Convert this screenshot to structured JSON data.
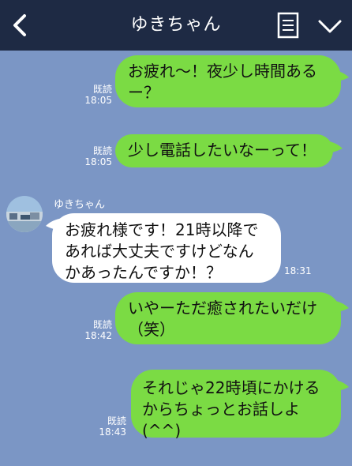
{
  "header": {
    "title": "ゆきちゃん",
    "back_icon": "chevron-left-icon",
    "memo_icon": "note-icon",
    "menu_icon": "chevron-down-icon"
  },
  "colors": {
    "header_bg": "#1e2a44",
    "chat_bg": "#7b96c5",
    "sent_bubble": "#7bdb44",
    "received_bubble": "#ffffff"
  },
  "messages": [
    {
      "direction": "sent",
      "text": "お疲れ〜！夜少し時間あるー？",
      "read": "既読",
      "time": "18:05"
    },
    {
      "direction": "sent",
      "text": "少し電話したいなーって！",
      "read": "既読",
      "time": "18:05"
    },
    {
      "direction": "received",
      "sender": "ゆきちゃん",
      "text": "お疲れ様です！21時以降であれば大丈夫ですけどなんかあったんですか！？",
      "time": "18:31"
    },
    {
      "direction": "sent",
      "text": "いやーただ癒されたいだけ（笑）",
      "read": "既読",
      "time": "18:42"
    },
    {
      "direction": "sent",
      "text": "それじゃ22時頃にかけるからちょっとお話しよ(^^)",
      "read": "既読",
      "time": "18:43"
    }
  ]
}
